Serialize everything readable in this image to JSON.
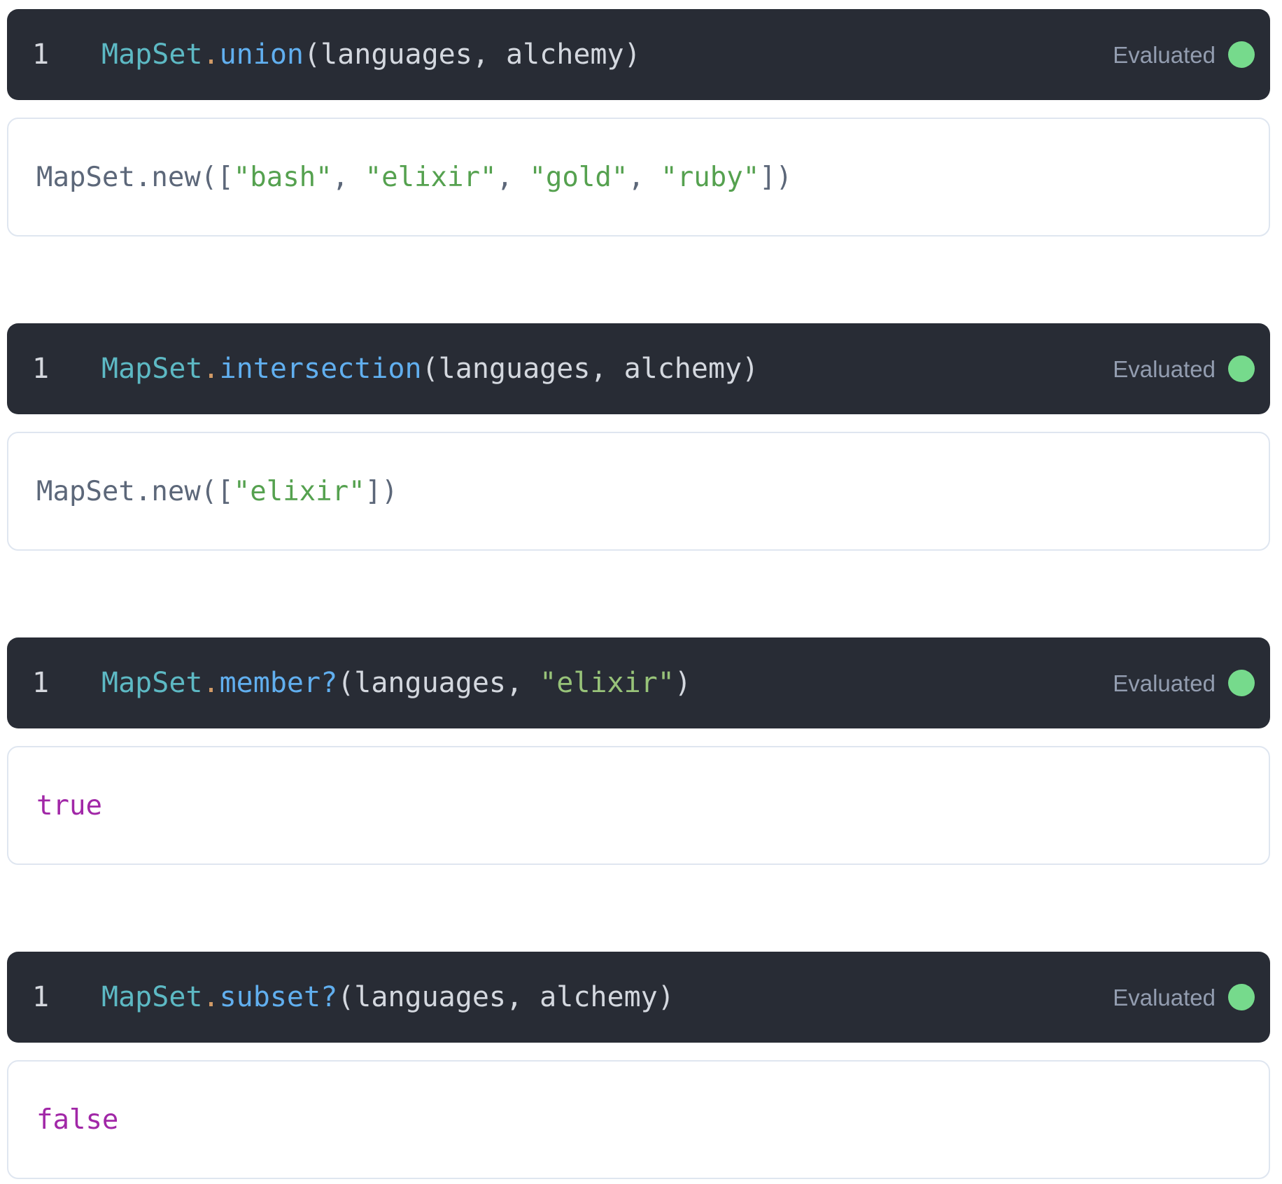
{
  "colors": {
    "editor_background": "#282c35",
    "evaluated_dot": "#76da8c",
    "status_text": "#939db0",
    "output_border": "#dfe6f0",
    "editor_token_colors": {
      "line_number": "#d5d8de",
      "module": "#5db9c4",
      "operator": "#d19a66",
      "function": "#61afef",
      "plain": "#d4d8df",
      "string": "#98c379"
    },
    "output_token_colors": {
      "plain": "#5c6779",
      "string": "#55a14f",
      "boolean": "#a127a7"
    }
  },
  "cells": [
    {
      "line_number": "1",
      "status": "Evaluated",
      "code": [
        [
          "MapSet",
          "module"
        ],
        [
          ".",
          "operator"
        ],
        [
          "union",
          "function"
        ],
        [
          "(languages, alchemy)",
          "plain"
        ]
      ],
      "output": [
        [
          "MapSet.new([",
          "plain"
        ],
        [
          "\"bash\"",
          "string"
        ],
        [
          ", ",
          "plain"
        ],
        [
          "\"elixir\"",
          "string"
        ],
        [
          ", ",
          "plain"
        ],
        [
          "\"gold\"",
          "string"
        ],
        [
          ", ",
          "plain"
        ],
        [
          "\"ruby\"",
          "string"
        ],
        [
          "])",
          "plain"
        ]
      ]
    },
    {
      "line_number": "1",
      "status": "Evaluated",
      "code": [
        [
          "MapSet",
          "module"
        ],
        [
          ".",
          "operator"
        ],
        [
          "intersection",
          "function"
        ],
        [
          "(languages, alchemy)",
          "plain"
        ]
      ],
      "output": [
        [
          "MapSet.new([",
          "plain"
        ],
        [
          "\"elixir\"",
          "string"
        ],
        [
          "])",
          "plain"
        ]
      ]
    },
    {
      "line_number": "1",
      "status": "Evaluated",
      "code": [
        [
          "MapSet",
          "module"
        ],
        [
          ".",
          "operator"
        ],
        [
          "member?",
          "function"
        ],
        [
          "(languages, ",
          "plain"
        ],
        [
          "\"elixir\"",
          "string"
        ],
        [
          ")",
          "plain"
        ]
      ],
      "output": [
        [
          "true",
          "boolean"
        ]
      ]
    },
    {
      "line_number": "1",
      "status": "Evaluated",
      "code": [
        [
          "MapSet",
          "module"
        ],
        [
          ".",
          "operator"
        ],
        [
          "subset?",
          "function"
        ],
        [
          "(languages, alchemy)",
          "plain"
        ]
      ],
      "output": [
        [
          "false",
          "boolean"
        ]
      ]
    }
  ]
}
